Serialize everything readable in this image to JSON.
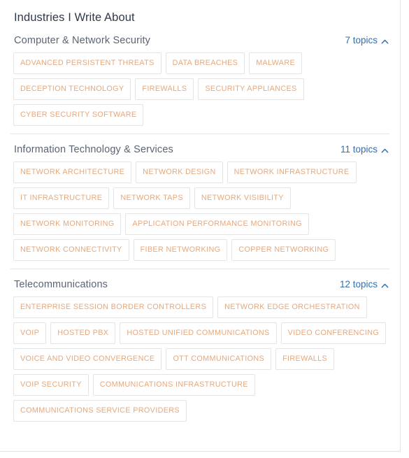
{
  "page": {
    "title": "Industries I Write About"
  },
  "icons": {
    "collapse": "chevron-up-icon"
  },
  "colors": {
    "title_text": "#2f3a4a",
    "section_text": "#5a6473",
    "link_blue": "#2f6fb4",
    "tag_text": "#e5a87c",
    "tag_border": "#e4e4e4",
    "divider": "#e6e6e6",
    "card_background": "#ffffff"
  },
  "sections": [
    {
      "name": "Computer & Network Security",
      "topic_count_label": "7 topics",
      "expanded": true,
      "tags": [
        "ADVANCED PERSISTENT THREATS",
        "DATA BREACHES",
        "MALWARE",
        "DECEPTION TECHNOLOGY",
        "FIREWALLS",
        "SECURITY APPLIANCES",
        "CYBER SECURITY SOFTWARE"
      ]
    },
    {
      "name": "Information Technology & Services",
      "topic_count_label": "11 topics",
      "expanded": true,
      "tags": [
        "NETWORK ARCHITECTURE",
        "NETWORK DESIGN",
        "NETWORK INFRASTRUCTURE",
        "IT INFRASTRUCTURE",
        "NETWORK TAPS",
        "NETWORK VISIBILITY",
        "NETWORK MONITORING",
        "APPLICATION PERFORMANCE MONITORING",
        "NETWORK CONNECTIVITY",
        "FIBER NETWORKING",
        "COPPER NETWORKING"
      ]
    },
    {
      "name": "Telecommunications",
      "topic_count_label": "12 topics",
      "expanded": true,
      "tags": [
        "ENTERPRISE SESSION BORDER CONTROLLERS",
        "NETWORK EDGE ORCHESTRATION",
        "VOIP",
        "HOSTED PBX",
        "HOSTED UNIFIED COMMUNICATIONS",
        "VIDEO CONFERENCING",
        "VOICE AND VIDEO CONVERGENCE",
        "OTT COMMUNICATIONS",
        "FIREWALLS",
        "VOIP SECURITY",
        "COMMUNICATIONS INFRASTRUCTURE",
        "COMMUNICATIONS SERVICE PROVIDERS"
      ]
    }
  ]
}
